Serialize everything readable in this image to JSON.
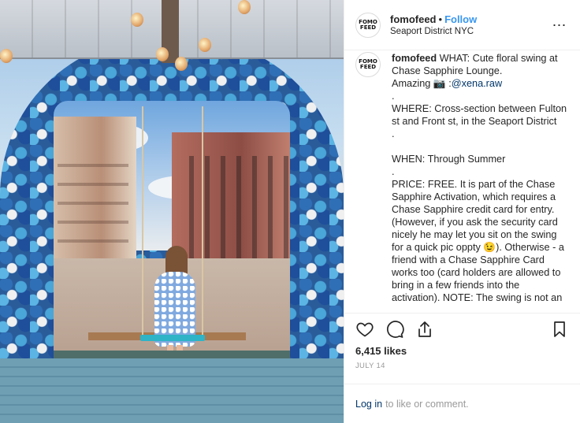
{
  "post": {
    "image_alt": "Woman on floral swing under blue flower arch in Seaport District"
  },
  "header": {
    "avatar_text": "FOMO FEED",
    "username": "fomofeed",
    "separator": "•",
    "follow_label": "Follow",
    "location": "Seaport District NYC",
    "more_icon": "⋯"
  },
  "caption": {
    "avatar_text": "FOMO FEED",
    "username": "fomofeed",
    "line1": "WHAT: Cute floral swing at Chase Sapphire Lounge.",
    "amazing": "Amazing 📷 :",
    "mention": "@xena.raw",
    "dot1": ".",
    "where": "WHERE: Cross-section between Fulton st and Front st, in the Seaport District",
    "dot2": ".",
    "when": "WHEN: Through Summer",
    "dot3": ".",
    "price": "PRICE: FREE. It is part of the Chase Sapphire Activation, which requires a Chase Sapphire credit card for entry. (However, if you ask the security card nicely he may let you sit on the swing for a quick pic oppty 😉). Otherwise - a friend with a Chase Sapphire Card works too (card holders are allowed to bring in a few friends into the activation). NOTE: The swing is not an"
  },
  "actions": {
    "like_icon": "heart-icon",
    "comment_icon": "comment-icon",
    "share_icon": "share-icon",
    "save_icon": "bookmark-icon"
  },
  "likes": "6,415 likes",
  "date": "JULY 14",
  "login": {
    "link": "Log in",
    "text": "to like or comment."
  }
}
